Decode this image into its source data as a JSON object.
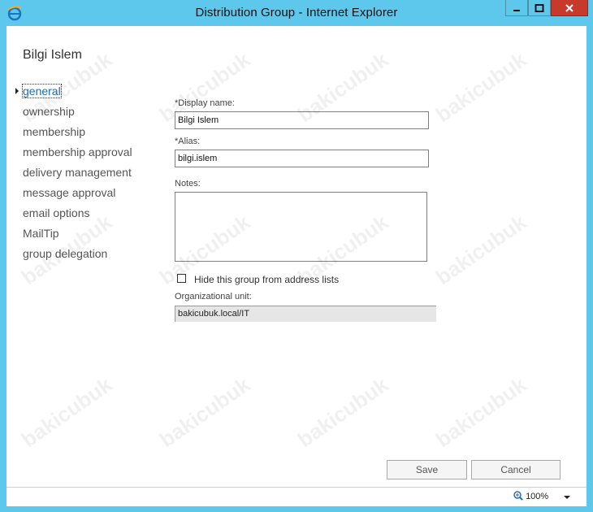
{
  "window": {
    "title": "Distribution Group - Internet Explorer",
    "icons": {
      "app": "ie-icon",
      "minimize": "minimize-icon",
      "maximize": "maximize-icon",
      "close": "close-icon"
    }
  },
  "page": {
    "title": "Bilgi Islem"
  },
  "nav": {
    "items": [
      {
        "label": "general",
        "active": true
      },
      {
        "label": "ownership"
      },
      {
        "label": "membership"
      },
      {
        "label": "membership approval"
      },
      {
        "label": "delivery management"
      },
      {
        "label": "message approval"
      },
      {
        "label": "email options"
      },
      {
        "label": "MailTip"
      },
      {
        "label": "group delegation"
      }
    ]
  },
  "form": {
    "display_name_label": "*Display name:",
    "display_name_value": "Bilgi Islem",
    "alias_label": "*Alias:",
    "alias_value": "bilgi.islem",
    "notes_label": "Notes:",
    "notes_value": "",
    "hide_label": "Hide this group from address lists",
    "hide_checked": false,
    "ou_label": "Organizational unit:",
    "ou_value": "bakicubuk.local/IT"
  },
  "footer": {
    "save": "Save",
    "cancel": "Cancel"
  },
  "status": {
    "zoom": "100%"
  },
  "watermark": "bakicubuk"
}
